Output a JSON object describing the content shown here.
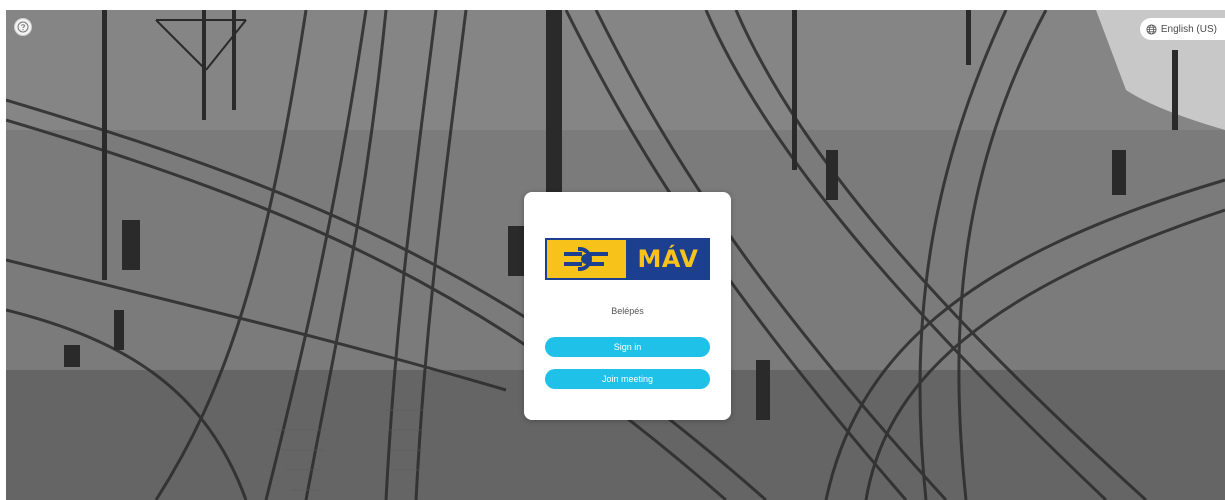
{
  "header": {
    "language_label": "English (US)"
  },
  "icons": {
    "help": "help-circle-icon",
    "language": "globe-icon"
  },
  "card": {
    "logo_text": "MÁV",
    "subtitle": "Belépés",
    "sign_in_label": "Sign in",
    "join_meeting_label": "Join meeting"
  },
  "colors": {
    "button": "#1fc1e8",
    "logo_yellow": "#f7c31a",
    "logo_blue": "#1d3f8f"
  }
}
